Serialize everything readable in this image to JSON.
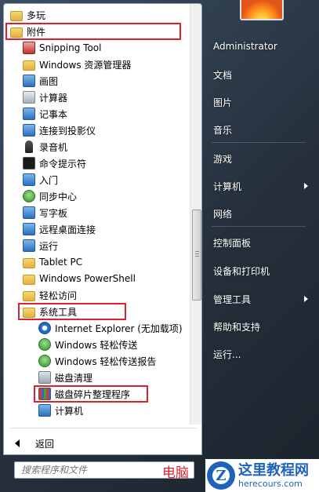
{
  "programs": [
    {
      "label": "多玩",
      "icon": "folder-icon"
    },
    {
      "label": "附件",
      "icon": "folder-icon"
    },
    {
      "label": "Snipping Tool",
      "icon": "snipping-tool-icon"
    },
    {
      "label": "Windows 资源管理器",
      "icon": "explorer-icon"
    },
    {
      "label": "画图",
      "icon": "paint-icon"
    },
    {
      "label": "计算器",
      "icon": "calculator-icon"
    },
    {
      "label": "记事本",
      "icon": "notepad-icon"
    },
    {
      "label": "连接到投影仪",
      "icon": "projector-icon"
    },
    {
      "label": "录音机",
      "icon": "microphone-icon"
    },
    {
      "label": "命令提示符",
      "icon": "cmd-icon"
    },
    {
      "label": "入门",
      "icon": "getting-started-icon"
    },
    {
      "label": "同步中心",
      "icon": "sync-center-icon"
    },
    {
      "label": "写字板",
      "icon": "wordpad-icon"
    },
    {
      "label": "远程桌面连接",
      "icon": "remote-desktop-icon"
    },
    {
      "label": "运行",
      "icon": "run-icon"
    },
    {
      "label": "Tablet PC",
      "icon": "folder-icon"
    },
    {
      "label": "Windows PowerShell",
      "icon": "folder-icon"
    },
    {
      "label": "轻松访问",
      "icon": "folder-icon"
    },
    {
      "label": "系统工具",
      "icon": "folder-icon"
    },
    {
      "label": "Internet Explorer (无加载项)",
      "icon": "ie-icon"
    },
    {
      "label": "Windows 轻松传送",
      "icon": "easy-transfer-icon"
    },
    {
      "label": "Windows 轻松传送报告",
      "icon": "easy-transfer-report-icon"
    },
    {
      "label": "磁盘清理",
      "icon": "disk-cleanup-icon"
    },
    {
      "label": "磁盘碎片整理程序",
      "icon": "defrag-icon"
    },
    {
      "label": "计算机",
      "icon": "computer-icon"
    }
  ],
  "back_label": "返回",
  "search": {
    "placeholder": "搜索程序和文件"
  },
  "right_items": [
    {
      "label": "Administrator",
      "submenu": false
    },
    {
      "label": "文档",
      "submenu": false
    },
    {
      "label": "图片",
      "submenu": false
    },
    {
      "label": "音乐",
      "submenu": false
    },
    {
      "label": "游戏",
      "submenu": false
    },
    {
      "label": "计算机",
      "submenu": true
    },
    {
      "label": "网络",
      "submenu": false
    },
    {
      "label": "控制面板",
      "submenu": false
    },
    {
      "label": "设备和打印机",
      "submenu": false
    },
    {
      "label": "管理工具",
      "submenu": true
    },
    {
      "label": "帮助和支持",
      "submenu": false
    },
    {
      "label": "运行...",
      "submenu": false
    }
  ],
  "watermark": {
    "left_text": "电脑",
    "logo_letter": "Z",
    "title": "这里教程网",
    "url": "herecours.com"
  },
  "colors": {
    "highlight": "#e0202a",
    "brand": "#1f63b8"
  }
}
